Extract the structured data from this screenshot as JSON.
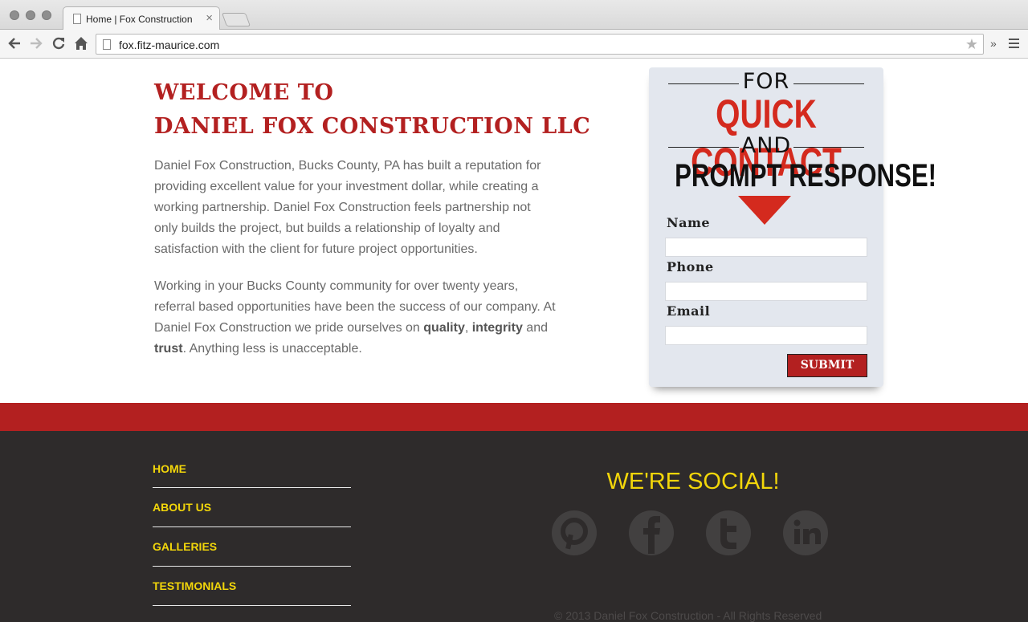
{
  "browser": {
    "tab_title": "Home | Fox Construction",
    "url": "fox.fitz-maurice.com",
    "close_glyph": "×",
    "overflow_glyph": "»"
  },
  "main": {
    "heading_line1": "WELCOME TO",
    "heading_line2": "DANIEL FOX CONSTRUCTION LLC",
    "paragraph1": "Daniel Fox Construction, Bucks County, PA has built a reputation for providing excellent value for your investment dollar, while creating a working partnership. Daniel Fox Construction feels partnership not only builds the project, but builds a relationship of loyalty and satisfaction with the client for future project opportunities.",
    "paragraph2_start": "Working in your Bucks County community for over twenty years, referral based opportunities have been the success of our company. At Daniel Fox Construction we pride ourselves on ",
    "bold_quality": "quality",
    "comma": ", ",
    "bold_integrity": "integrity",
    "and_text": " and ",
    "bold_trust": "trust",
    "paragraph2_end": ". Anything less is unacceptable."
  },
  "contact": {
    "for": "FOR",
    "quick": "QUICK CONTACT",
    "and": "AND",
    "prompt": "PROMPT RESPONSE!",
    "name_label": "Name",
    "phone_label": "Phone",
    "email_label": "Email",
    "submit_label": "SUBMIT"
  },
  "footer": {
    "nav": [
      "HOME",
      "ABOUT US",
      "GALLERIES",
      "TESTIMONIALS"
    ],
    "social_title": "WE'RE SOCIAL!",
    "social_icons": [
      "pinterest-icon",
      "facebook-icon",
      "twitter-icon",
      "linkedin-icon"
    ],
    "social_glyphs": [
      "P",
      "f",
      "t",
      "in"
    ],
    "copyright": "© 2013 Daniel Fox Construction - All Rights Reserved"
  },
  "colors": {
    "brand_red": "#b32020",
    "accent_red": "#d42a1e",
    "footer_bg": "#2e2b2b",
    "nav_yellow": "#f2d60a"
  }
}
